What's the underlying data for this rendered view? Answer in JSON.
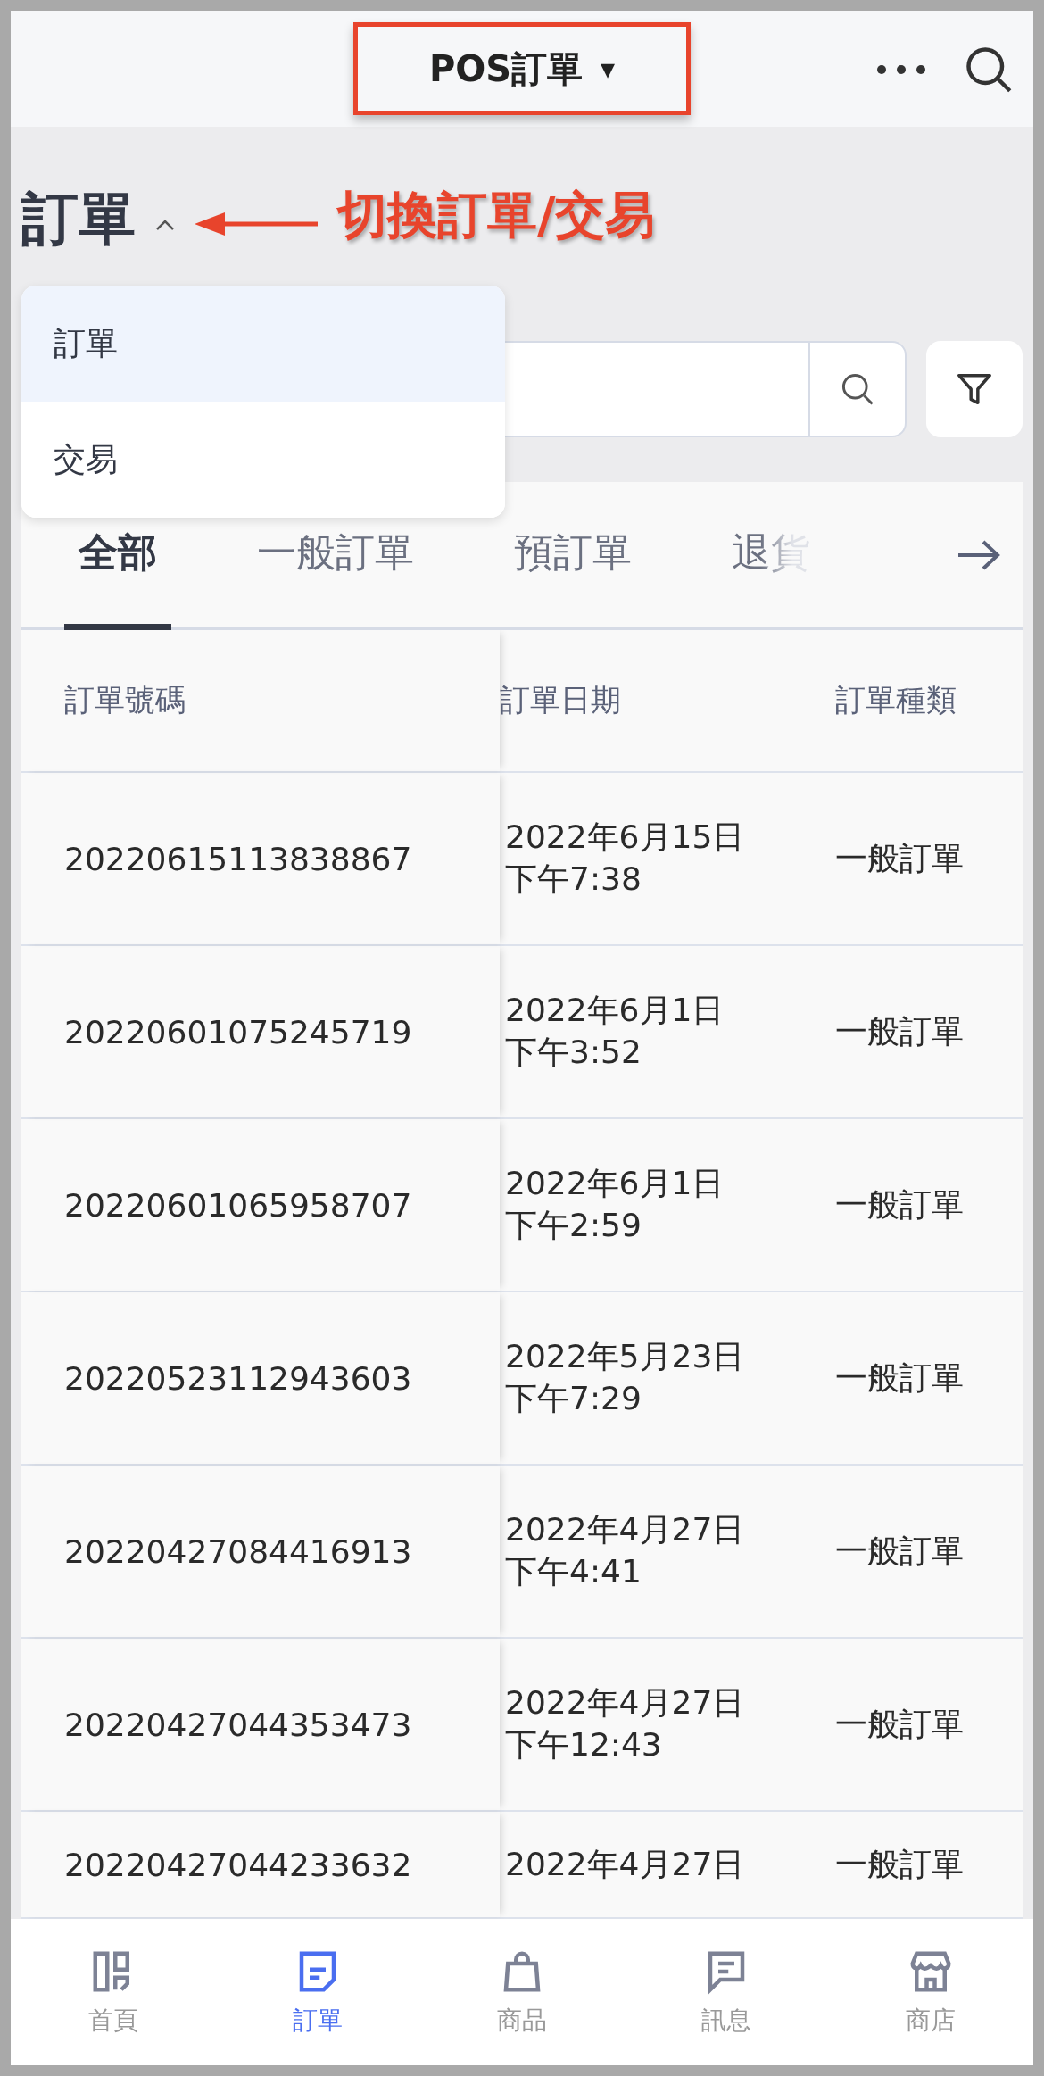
{
  "header": {
    "title": "POS訂單",
    "caret": "▾"
  },
  "page_title": {
    "text": "訂單",
    "expanded": true
  },
  "annotation": "切換訂單/交易",
  "dropdown": [
    {
      "label": "訂單",
      "selected": true
    },
    {
      "label": "交易",
      "selected": false
    }
  ],
  "tabs": [
    {
      "label": "全部",
      "selected": true
    },
    {
      "label": "一般訂單",
      "selected": false
    },
    {
      "label": "預訂單",
      "selected": false
    },
    {
      "label": "退貨",
      "selected": false
    }
  ],
  "table": {
    "columns": [
      "訂單號碼",
      "訂單日期",
      "訂單種類"
    ],
    "rows": [
      {
        "number": "20220615113838867",
        "date": [
          "2022年6月15日",
          "下午7:38"
        ],
        "type": "一般訂單"
      },
      {
        "number": "20220601075245719",
        "date": [
          "2022年6月1日",
          "下午3:52"
        ],
        "type": "一般訂單"
      },
      {
        "number": "20220601065958707",
        "date": [
          "2022年6月1日",
          "下午2:59"
        ],
        "type": "一般訂單"
      },
      {
        "number": "20220523112943603",
        "date": [
          "2022年5月23日",
          "下午7:29"
        ],
        "type": "一般訂單"
      },
      {
        "number": "20220427084416913",
        "date": [
          "2022年4月27日",
          "下午4:41"
        ],
        "type": "一般訂單"
      },
      {
        "number": "20220427044353473",
        "date": [
          "2022年4月27日",
          "下午12:43"
        ],
        "type": "一般訂單"
      },
      {
        "number": "20220427044233632",
        "date": [
          "2022年4月27日"
        ],
        "type": "一般訂單"
      }
    ]
  },
  "nav": [
    {
      "label": "首頁",
      "kind": "home",
      "selected": false
    },
    {
      "label": "訂單",
      "kind": "orders",
      "selected": true
    },
    {
      "label": "商品",
      "kind": "products",
      "selected": false
    },
    {
      "label": "訊息",
      "kind": "messages",
      "selected": false
    },
    {
      "label": "商店",
      "kind": "store",
      "selected": false
    }
  ]
}
